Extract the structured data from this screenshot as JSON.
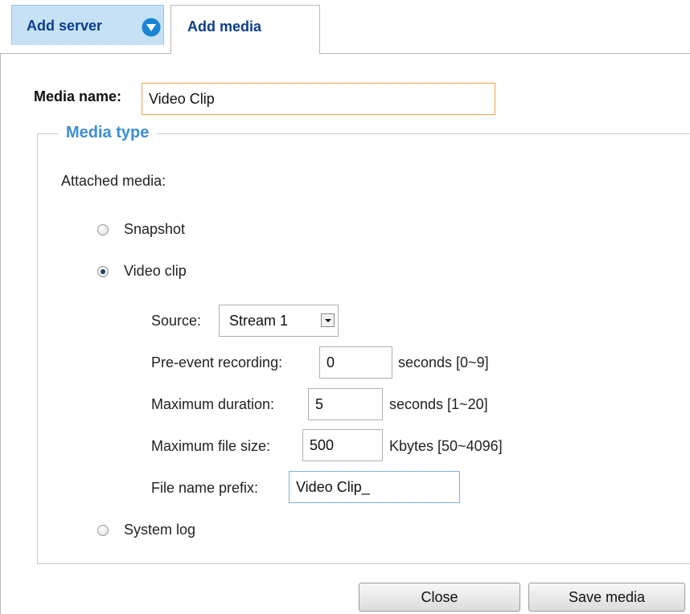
{
  "tabs": {
    "add_server": "Add server",
    "add_media": "Add media"
  },
  "form": {
    "media_name_label": "Media name:",
    "media_name_value": "Video Clip",
    "media_type_legend": "Media type",
    "attached_media_label": "Attached media:",
    "options": {
      "snapshot": "Snapshot",
      "video_clip": "Video clip",
      "system_log": "System log"
    },
    "selected_option": "video_clip",
    "video": {
      "source_label": "Source:",
      "source_value": "Stream 1",
      "pre_event_label": "Pre-event recording:",
      "pre_event_value": "0",
      "pre_event_unit": "seconds [0~9]",
      "max_duration_label": "Maximum duration:",
      "max_duration_value": "5",
      "max_duration_unit": "seconds [1~20]",
      "max_file_size_label": "Maximum file size:",
      "max_file_size_value": "500",
      "max_file_size_unit": "Kbytes [50~4096]",
      "prefix_label": "File name prefix:",
      "prefix_value": "Video Clip_"
    }
  },
  "buttons": {
    "close": "Close",
    "save": "Save media"
  },
  "colors": {
    "tab_active_bg": "#c6e1f5",
    "legend": "#3b8fd4",
    "link": "#0b3e8c",
    "focus_orange": "#f0a050",
    "focus_blue": "#7fb2df"
  }
}
